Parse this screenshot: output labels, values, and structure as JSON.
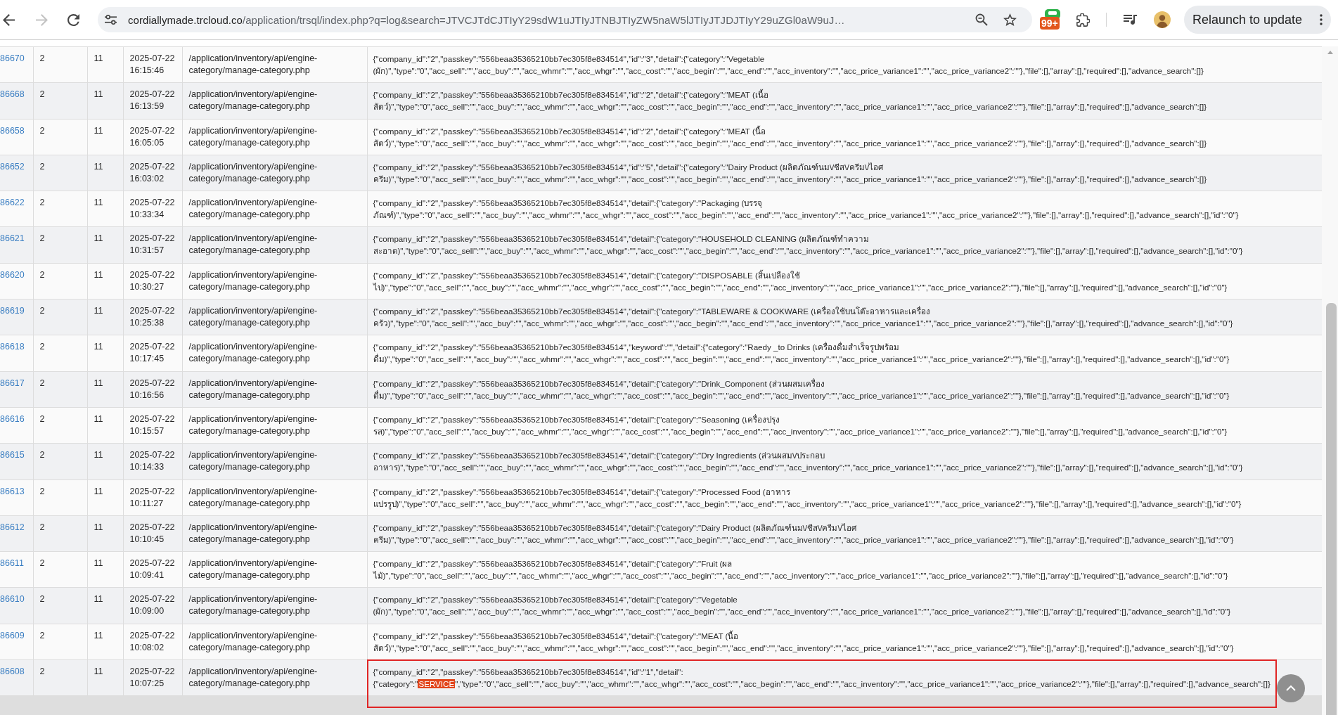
{
  "browser": {
    "back_disabled": false,
    "forward_disabled": true,
    "url_host": "cordiallymade.trcloud.co",
    "url_path": "/application/trsql/index.php?q=log&search=JTVCJTdCJTIyY29sdW1uJTIyJTNBJTIyZW5naW5lJTIyJTJDJTIyY29uZGl0aW9uJ…",
    "extension_badge": "99+",
    "relaunch_button": "Relaunch to update"
  },
  "table": {
    "rows": [
      {
        "column_1": "86670",
        "column_2": "2",
        "column_3": "11",
        "column_4": "2025-07-22 16:15:46",
        "column_5": "/application/inventory/api/engine-category/manage-category.php",
        "column_6": [
          {
            "text": "{\"company_id\":\"2\",\"passkey\":\"556beaa35365210bb7ec305f8e834514\",\"id\":\"3\",\"detail\":{\"category\":\"Vegetable (ผัก)\",\"type\":\"0\",\"acc_sell\":\"\",\"acc_buy\":\"\",\"acc_whmr\":\"\",\"acc_whgr\":\"\",\"acc_cost\":\"\",\"acc_begin\":\"\",\"acc_end\":\"\",\"acc_inventory\":\"\",\"acc_price_variance1\":\"\",\"acc_price_variance2\":\"\"},\"file\":[],\"array\":[],\"required\":[],\"advance_search\":[]}",
            "highlighted": false
          }
        ],
        "outlined": false
      },
      {
        "column_1": "86668",
        "column_2": "2",
        "column_3": "11",
        "column_4": "2025-07-22 16:13:59",
        "column_5": "/application/inventory/api/engine-category/manage-category.php",
        "column_6": [
          {
            "text": "{\"company_id\":\"2\",\"passkey\":\"556beaa35365210bb7ec305f8e834514\",\"id\":\"2\",\"detail\":{\"category\":\"MEAT (เนื้อสัตว์)\",\"type\":\"0\",\"acc_sell\":\"\",\"acc_buy\":\"\",\"acc_whmr\":\"\",\"acc_whgr\":\"\",\"acc_cost\":\"\",\"acc_begin\":\"\",\"acc_end\":\"\",\"acc_inventory\":\"\",\"acc_price_variance1\":\"\",\"acc_price_variance2\":\"\"},\"file\":[],\"array\":[],\"required\":[],\"advance_search\":[]}",
            "highlighted": false
          }
        ],
        "outlined": false
      },
      {
        "column_1": "86658",
        "column_2": "2",
        "column_3": "11",
        "column_4": "2025-07-22 16:05:05",
        "column_5": "/application/inventory/api/engine-category/manage-category.php",
        "column_6": [
          {
            "text": "{\"company_id\":\"2\",\"passkey\":\"556beaa35365210bb7ec305f8e834514\",\"id\":\"2\",\"detail\":{\"category\":\"MEAT (นื้อสัตว์)\",\"type\":\"0\",\"acc_sell\":\"\",\"acc_buy\":\"\",\"acc_whmr\":\"\",\"acc_whgr\":\"\",\"acc_cost\":\"\",\"acc_begin\":\"\",\"acc_end\":\"\",\"acc_inventory\":\"\",\"acc_price_variance1\":\"\",\"acc_price_variance2\":\"\"},\"file\":[],\"array\":[],\"required\":[],\"advance_search\":[]}",
            "highlighted": false
          }
        ],
        "outlined": false
      },
      {
        "column_1": "86652",
        "column_2": "2",
        "column_3": "11",
        "column_4": "2025-07-22 16:03:02",
        "column_5": "/application/inventory/api/engine-category/manage-category.php",
        "column_6": [
          {
            "text": "{\"company_id\":\"2\",\"passkey\":\"556beaa35365210bb7ec305f8e834514\",\"id\":\"5\",\"detail\":{\"category\":\"Dairy Product (ผลิตภัณฑ์นม\\/ชีส\\/ครีม\\/ไอศครีม)\",\"type\":\"0\",\"acc_sell\":\"\",\"acc_buy\":\"\",\"acc_whmr\":\"\",\"acc_whgr\":\"\",\"acc_cost\":\"\",\"acc_begin\":\"\",\"acc_end\":\"\",\"acc_inventory\":\"\",\"acc_price_variance1\":\"\",\"acc_price_variance2\":\"\"},\"file\":[],\"array\":[],\"required\":[],\"advance_search\":[]}",
            "highlighted": false
          }
        ],
        "outlined": false
      },
      {
        "column_1": "86622",
        "column_2": "2",
        "column_3": "11",
        "column_4": "2025-07-22 10:33:34",
        "column_5": "/application/inventory/api/engine-category/manage-category.php",
        "column_6": [
          {
            "text": "{\"company_id\":\"2\",\"passkey\":\"556beaa35365210bb7ec305f8e834514\",\"detail\":{\"category\":\"Packaging (บรรจุภัณฑ์)\",\"type\":\"0\",\"acc_sell\":\"\",\"acc_buy\":\"\",\"acc_whmr\":\"\",\"acc_whgr\":\"\",\"acc_cost\":\"\",\"acc_begin\":\"\",\"acc_end\":\"\",\"acc_inventory\":\"\",\"acc_price_variance1\":\"\",\"acc_price_variance2\":\"\"},\"file\":[],\"array\":[],\"required\":[],\"advance_search\":[],\"id\":\"0\"}",
            "highlighted": false
          }
        ],
        "outlined": false
      },
      {
        "column_1": "86621",
        "column_2": "2",
        "column_3": "11",
        "column_4": "2025-07-22 10:31:57",
        "column_5": "/application/inventory/api/engine-category/manage-category.php",
        "column_6": [
          {
            "text": "{\"company_id\":\"2\",\"passkey\":\"556beaa35365210bb7ec305f8e834514\",\"detail\":{\"category\":\"HOUSEHOLD CLEANING (ผลิตภัณฑ์ทำความสะอาด)\",\"type\":\"0\",\"acc_sell\":\"\",\"acc_buy\":\"\",\"acc_whmr\":\"\",\"acc_whgr\":\"\",\"acc_cost\":\"\",\"acc_begin\":\"\",\"acc_end\":\"\",\"acc_inventory\":\"\",\"acc_price_variance1\":\"\",\"acc_price_variance2\":\"\"},\"file\":[],\"array\":[],\"required\":[],\"advance_search\":[],\"id\":\"0\"}",
            "highlighted": false
          }
        ],
        "outlined": false
      },
      {
        "column_1": "86620",
        "column_2": "2",
        "column_3": "11",
        "column_4": "2025-07-22 10:30:27",
        "column_5": "/application/inventory/api/engine-category/manage-category.php",
        "column_6": [
          {
            "text": "{\"company_id\":\"2\",\"passkey\":\"556beaa35365210bb7ec305f8e834514\",\"detail\":{\"category\":\"DISPOSABLE (สิ้นเปลืองใช้ไป)\",\"type\":\"0\",\"acc_sell\":\"\",\"acc_buy\":\"\",\"acc_whmr\":\"\",\"acc_whgr\":\"\",\"acc_cost\":\"\",\"acc_begin\":\"\",\"acc_end\":\"\",\"acc_inventory\":\"\",\"acc_price_variance1\":\"\",\"acc_price_variance2\":\"\"},\"file\":[],\"array\":[],\"required\":[],\"advance_search\":[],\"id\":\"0\"}",
            "highlighted": false
          }
        ],
        "outlined": false
      },
      {
        "column_1": "86619",
        "column_2": "2",
        "column_3": "11",
        "column_4": "2025-07-22 10:25:38",
        "column_5": "/application/inventory/api/engine-category/manage-category.php",
        "column_6": [
          {
            "text": "{\"company_id\":\"2\",\"passkey\":\"556beaa35365210bb7ec305f8e834514\",\"detail\":{\"category\":\"TABLEWARE & COOKWARE (เครื่องใช้บนโต๊ะอาหารและเครื่องครัว)\",\"type\":\"0\",\"acc_sell\":\"\",\"acc_buy\":\"\",\"acc_whmr\":\"\",\"acc_whgr\":\"\",\"acc_cost\":\"\",\"acc_begin\":\"\",\"acc_end\":\"\",\"acc_inventory\":\"\",\"acc_price_variance1\":\"\",\"acc_price_variance2\":\"\"},\"file\":[],\"array\":[],\"required\":[],\"advance_search\":[],\"id\":\"0\"}",
            "highlighted": false
          }
        ],
        "outlined": false
      },
      {
        "column_1": "86618",
        "column_2": "2",
        "column_3": "11",
        "column_4": "2025-07-22 10:17:45",
        "column_5": "/application/inventory/api/engine-category/manage-category.php",
        "column_6": [
          {
            "text": "{\"company_id\":\"2\",\"passkey\":\"556beaa35365210bb7ec305f8e834514\",\"keyword\":\"\",\"detail\":{\"category\":\"Raedy _to Drinks (เครื่องดื่มสำเร็จรูปพร้อมดื่ม)\",\"type\":\"0\",\"acc_sell\":\"\",\"acc_buy\":\"\",\"acc_whmr\":\"\",\"acc_whgr\":\"\",\"acc_cost\":\"\",\"acc_begin\":\"\",\"acc_end\":\"\",\"acc_inventory\":\"\",\"acc_price_variance1\":\"\",\"acc_price_variance2\":\"\"},\"file\":[],\"array\":[],\"required\":[],\"advance_search\":[],\"id\":\"0\"}",
            "highlighted": false
          }
        ],
        "outlined": false
      },
      {
        "column_1": "86617",
        "column_2": "2",
        "column_3": "11",
        "column_4": "2025-07-22 10:16:56",
        "column_5": "/application/inventory/api/engine-category/manage-category.php",
        "column_6": [
          {
            "text": "{\"company_id\":\"2\",\"passkey\":\"556beaa35365210bb7ec305f8e834514\",\"detail\":{\"category\":\"Drink_Component (ส่วนผสมเครื่องดื่ม)\",\"type\":\"0\",\"acc_sell\":\"\",\"acc_buy\":\"\",\"acc_whmr\":\"\",\"acc_whgr\":\"\",\"acc_cost\":\"\",\"acc_begin\":\"\",\"acc_end\":\"\",\"acc_inventory\":\"\",\"acc_price_variance1\":\"\",\"acc_price_variance2\":\"\"},\"file\":[],\"array\":[],\"required\":[],\"advance_search\":[],\"id\":\"0\"}",
            "highlighted": false
          }
        ],
        "outlined": false
      },
      {
        "column_1": "86616",
        "column_2": "2",
        "column_3": "11",
        "column_4": "2025-07-22 10:15:57",
        "column_5": "/application/inventory/api/engine-category/manage-category.php",
        "column_6": [
          {
            "text": "{\"company_id\":\"2\",\"passkey\":\"556beaa35365210bb7ec305f8e834514\",\"detail\":{\"category\":\"Seasoning (เครื่องปรุงรส)\",\"type\":\"0\",\"acc_sell\":\"\",\"acc_buy\":\"\",\"acc_whmr\":\"\",\"acc_whgr\":\"\",\"acc_cost\":\"\",\"acc_begin\":\"\",\"acc_end\":\"\",\"acc_inventory\":\"\",\"acc_price_variance1\":\"\",\"acc_price_variance2\":\"\"},\"file\":[],\"array\":[],\"required\":[],\"advance_search\":[],\"id\":\"0\"}",
            "highlighted": false
          }
        ],
        "outlined": false
      },
      {
        "column_1": "86615",
        "column_2": "2",
        "column_3": "11",
        "column_4": "2025-07-22 10:14:33",
        "column_5": "/application/inventory/api/engine-category/manage-category.php",
        "column_6": [
          {
            "text": "{\"company_id\":\"2\",\"passkey\":\"556beaa35365210bb7ec305f8e834514\",\"detail\":{\"category\":\"Dry Ingredients (ส่วนผสม\\/ประกอบอาหาร)\",\"type\":\"0\",\"acc_sell\":\"\",\"acc_buy\":\"\",\"acc_whmr\":\"\",\"acc_whgr\":\"\",\"acc_cost\":\"\",\"acc_begin\":\"\",\"acc_end\":\"\",\"acc_inventory\":\"\",\"acc_price_variance1\":\"\",\"acc_price_variance2\":\"\"},\"file\":[],\"array\":[],\"required\":[],\"advance_search\":[],\"id\":\"0\"}",
            "highlighted": false
          }
        ],
        "outlined": false
      },
      {
        "column_1": "86613",
        "column_2": "2",
        "column_3": "11",
        "column_4": "2025-07-22 10:11:27",
        "column_5": "/application/inventory/api/engine-category/manage-category.php",
        "column_6": [
          {
            "text": "{\"company_id\":\"2\",\"passkey\":\"556beaa35365210bb7ec305f8e834514\",\"detail\":{\"category\":\"Processed Food (อาหารแปรรูป)\",\"type\":\"0\",\"acc_sell\":\"\",\"acc_buy\":\"\",\"acc_whmr\":\"\",\"acc_whgr\":\"\",\"acc_cost\":\"\",\"acc_begin\":\"\",\"acc_end\":\"\",\"acc_inventory\":\"\",\"acc_price_variance1\":\"\",\"acc_price_variance2\":\"\"},\"file\":[],\"array\":[],\"required\":[],\"advance_search\":[],\"id\":\"0\"}",
            "highlighted": false
          }
        ],
        "outlined": false
      },
      {
        "column_1": "86612",
        "column_2": "2",
        "column_3": "11",
        "column_4": "2025-07-22 10:10:45",
        "column_5": "/application/inventory/api/engine-category/manage-category.php",
        "column_6": [
          {
            "text": "{\"company_id\":\"2\",\"passkey\":\"556beaa35365210bb7ec305f8e834514\",\"detail\":{\"category\":\"Dairy Product (ผลิตภัณฑ์นม\\/ชีส\\/ครีม\\/ไอศครีม)\",\"type\":\"0\",\"acc_sell\":\"\",\"acc_buy\":\"\",\"acc_whmr\":\"\",\"acc_whgr\":\"\",\"acc_cost\":\"\",\"acc_begin\":\"\",\"acc_end\":\"\",\"acc_inventory\":\"\",\"acc_price_variance1\":\"\",\"acc_price_variance2\":\"\"},\"file\":[],\"array\":[],\"required\":[],\"advance_search\":[],\"id\":\"0\"}",
            "highlighted": false
          }
        ],
        "outlined": false
      },
      {
        "column_1": "86611",
        "column_2": "2",
        "column_3": "11",
        "column_4": "2025-07-22 10:09:41",
        "column_5": "/application/inventory/api/engine-category/manage-category.php",
        "column_6": [
          {
            "text": "{\"company_id\":\"2\",\"passkey\":\"556beaa35365210bb7ec305f8e834514\",\"detail\":{\"category\":\"Fruit (ผลไม้)\",\"type\":\"0\",\"acc_sell\":\"\",\"acc_buy\":\"\",\"acc_whmr\":\"\",\"acc_whgr\":\"\",\"acc_cost\":\"\",\"acc_begin\":\"\",\"acc_end\":\"\",\"acc_inventory\":\"\",\"acc_price_variance1\":\"\",\"acc_price_variance2\":\"\"},\"file\":[],\"array\":[],\"required\":[],\"advance_search\":[],\"id\":\"0\"}",
            "highlighted": false
          }
        ],
        "outlined": false
      },
      {
        "column_1": "86610",
        "column_2": "2",
        "column_3": "11",
        "column_4": "2025-07-22 10:09:00",
        "column_5": "/application/inventory/api/engine-category/manage-category.php",
        "column_6": [
          {
            "text": "{\"company_id\":\"2\",\"passkey\":\"556beaa35365210bb7ec305f8e834514\",\"detail\":{\"category\":\"Vegetable (ผัก)\",\"type\":\"0\",\"acc_sell\":\"\",\"acc_buy\":\"\",\"acc_whmr\":\"\",\"acc_whgr\":\"\",\"acc_cost\":\"\",\"acc_begin\":\"\",\"acc_end\":\"\",\"acc_inventory\":\"\",\"acc_price_variance1\":\"\",\"acc_price_variance2\":\"\"},\"file\":[],\"array\":[],\"required\":[],\"advance_search\":[],\"id\":\"0\"}",
            "highlighted": false
          }
        ],
        "outlined": false
      },
      {
        "column_1": "86609",
        "column_2": "2",
        "column_3": "11",
        "column_4": "2025-07-22 10:08:02",
        "column_5": "/application/inventory/api/engine-category/manage-category.php",
        "column_6": [
          {
            "text": "{\"company_id\":\"2\",\"passkey\":\"556beaa35365210bb7ec305f8e834514\",\"detail\":{\"category\":\"MEAT (นื้อสัตว์)\",\"type\":\"0\",\"acc_sell\":\"\",\"acc_buy\":\"\",\"acc_whmr\":\"\",\"acc_whgr\":\"\",\"acc_cost\":\"\",\"acc_begin\":\"\",\"acc_end\":\"\",\"acc_inventory\":\"\",\"acc_price_variance1\":\"\",\"acc_price_variance2\":\"\"},\"file\":[],\"array\":[],\"required\":[],\"advance_search\":[],\"id\":\"0\"}",
            "highlighted": false
          }
        ],
        "outlined": false
      },
      {
        "column_1": "86608",
        "column_2": "2",
        "column_3": "11",
        "column_4": "2025-07-22 10:07:25",
        "column_5": "/application/inventory/api/engine-category/manage-category.php",
        "column_6": [
          {
            "text": "{\"company_id\":\"2\",\"passkey\":\"556beaa35365210bb7ec305f8e834514\",\"id\":\"1\",\"detail\":{\"category\":\"",
            "highlighted": false
          },
          {
            "text": "SERVICE",
            "highlighted": true
          },
          {
            "text": "\",\"type\":\"0\",\"acc_sell\":\"\",\"acc_buy\":\"\",\"acc_whmr\":\"\",\"acc_whgr\":\"\",\"acc_cost\":\"\",\"acc_begin\":\"\",\"acc_end\":\"\",\"acc_inventory\":\"\",\"acc_price_variance1\":\"\",\"acc_price_variance2\":\"\"},\"file\":[],\"array\":[],\"required\":[],\"advance_search\":[]}",
            "highlighted": false
          }
        ],
        "outlined": true
      }
    ]
  }
}
